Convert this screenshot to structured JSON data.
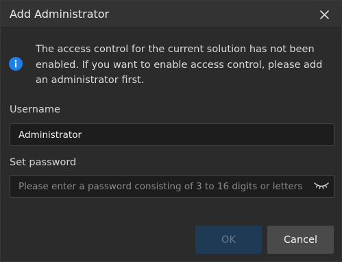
{
  "dialog": {
    "title": "Add Administrator",
    "close_icon": "close-icon"
  },
  "info": {
    "icon": "info-icon",
    "message": "The access control for the current solution has not been enabled. If you want to enable access control, please add an administrator first."
  },
  "form": {
    "username": {
      "label": "Username",
      "value": "Administrator"
    },
    "password": {
      "label": "Set password",
      "value": "",
      "placeholder": "Please enter a password consisting of 3 to 16 digits or letters",
      "toggle_icon": "eye-closed-icon"
    }
  },
  "buttons": {
    "ok_label": "OK",
    "ok_enabled": false,
    "cancel_label": "Cancel"
  },
  "colors": {
    "accent": "#1e7fe6",
    "ok_disabled_bg": "#1f3a55",
    "dialog_bg": "#2b2b2b"
  }
}
